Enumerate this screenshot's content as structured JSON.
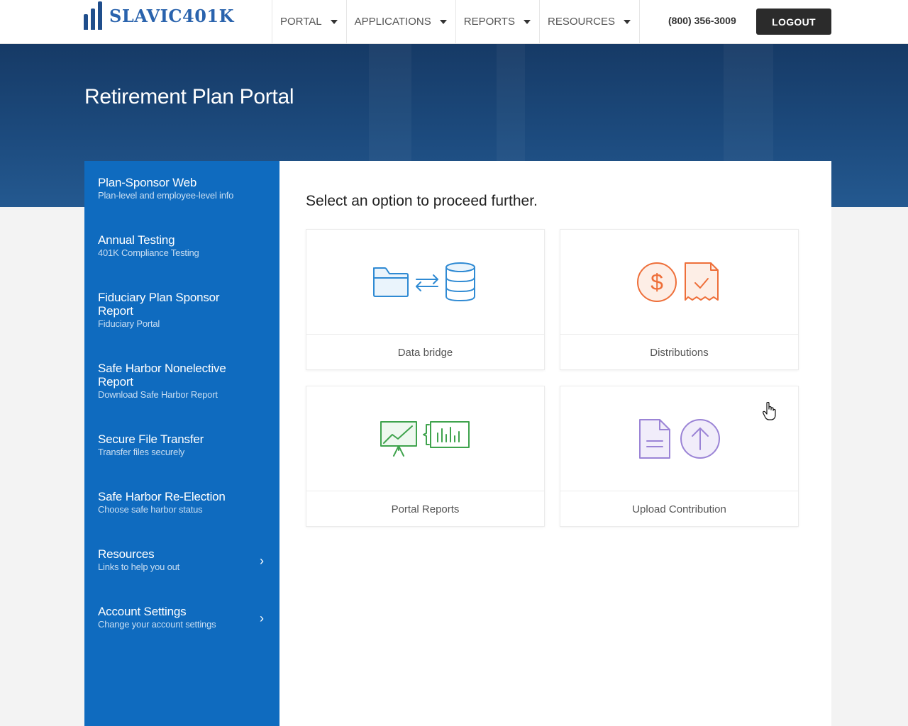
{
  "brand": {
    "logo_text": "SLAVIC401K"
  },
  "nav": [
    {
      "label": "PORTAL"
    },
    {
      "label": "APPLICATIONS"
    },
    {
      "label": "REPORTS"
    },
    {
      "label": "RESOURCES"
    }
  ],
  "header": {
    "phone": "(800) 356-3009",
    "logout_label": "LOGOUT"
  },
  "hero": {
    "title": "Retirement Plan Portal"
  },
  "sidebar": {
    "items": [
      {
        "title": "Plan-Sponsor Web",
        "subtitle": "Plan-level and employee-level info"
      },
      {
        "title": "Annual Testing",
        "subtitle": "401K Compliance Testing"
      },
      {
        "title": "Fiduciary Plan Sponsor Report",
        "subtitle": "Fiduciary Portal"
      },
      {
        "title": "Safe Harbor Nonelective Report",
        "subtitle": "Download Safe Harbor Report"
      },
      {
        "title": "Secure File Transfer",
        "subtitle": "Transfer files securely"
      },
      {
        "title": "Safe Harbor Re-Election",
        "subtitle": "Choose safe harbor status"
      },
      {
        "title": "Resources",
        "subtitle": "Links to help you out"
      },
      {
        "title": "Account Settings",
        "subtitle": "Change your account settings"
      }
    ]
  },
  "main": {
    "prompt": "Select an option to proceed further.",
    "cards": [
      {
        "label": "Data bridge",
        "icon": "data-bridge-icon",
        "color": "#2f8ad3"
      },
      {
        "label": "Distributions",
        "icon": "distributions-icon",
        "color": "#ee6f3a"
      },
      {
        "label": "Portal Reports",
        "icon": "portal-reports-icon",
        "color": "#3fa34d"
      },
      {
        "label": "Upload Contribution",
        "icon": "upload-contribution-icon",
        "color": "#9b84d6"
      }
    ]
  },
  "colors": {
    "sidebar": "#0f6bbf",
    "hero": "#1c4a7d",
    "logout": "#2b2b2b",
    "brand": "#2a63ad"
  }
}
